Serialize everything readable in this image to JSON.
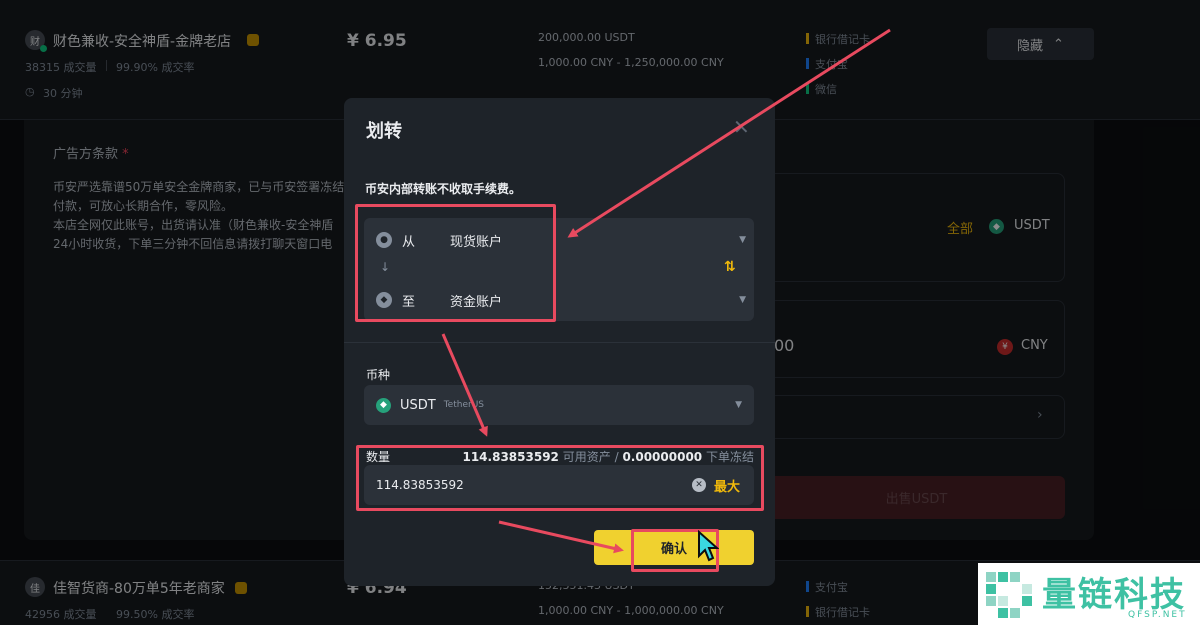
{
  "listing_top": {
    "avatar_char": "财",
    "merchant_name": "财色兼收-安全神盾-金牌老店",
    "orders": "38315 成交量",
    "completion": "99.90% 成交率",
    "time": "30 分钟",
    "price": "¥ 6.95",
    "available": "200,000.00 USDT",
    "limit": "1,000.00 CNY - 1,250,000.00 CNY",
    "payments": [
      "银行借记卡",
      "支付宝",
      "微信"
    ],
    "hide_label": "隐藏"
  },
  "panel": {
    "terms_title": "广告方条款",
    "terms_lines": [
      "币安严选靠谱50万单安全金牌商家，已与币安签署冻结",
      "付款，可放心长期合作，零风险。",
      "本店全网仅此账号，出货请认准（财色兼收-安全神盾",
      "24小时收货，下单三分钟不回信息请拨打聊天窗口电"
    ],
    "all_label": "全部",
    "usdt_label": "USDT",
    "cny_value": "00",
    "cny_label": "CNY",
    "sell_button": "出售USDT"
  },
  "listing_bottom": {
    "avatar_char": "佳",
    "merchant_name": "佳智货商-80万单5年老商家",
    "orders": "42956 成交量",
    "completion": "99.50% 成交率",
    "price": "¥ 6.94",
    "available": "152,351.43 USDT",
    "limit": "1,000.00 CNY - 1,000,000.00 CNY",
    "payments": [
      "支付宝",
      "银行借记卡"
    ]
  },
  "modal": {
    "title": "划转",
    "notice": "币安内部转账不收取手续费。",
    "from_label": "从",
    "from_account": "现货账户",
    "to_label": "至",
    "to_account": "资金账户",
    "coin_label": "币种",
    "coin_symbol": "USDT",
    "coin_name": "TetherUS",
    "qty_label": "数量",
    "available_amount": "114.83853592",
    "available_text": "可用资产",
    "separator": "/",
    "frozen_amount": "0.00000000",
    "frozen_text": "下单冻结",
    "qty_value": "114.83853592",
    "max_label": "最大",
    "confirm_label": "确认"
  },
  "watermark": {
    "brand": "量链科技",
    "domain": "QFSP.NET"
  },
  "colors": {
    "accent_yellow": "#f0d12f",
    "annotation_red": "#e84a5f",
    "brand_green": "#3ec1a3"
  }
}
